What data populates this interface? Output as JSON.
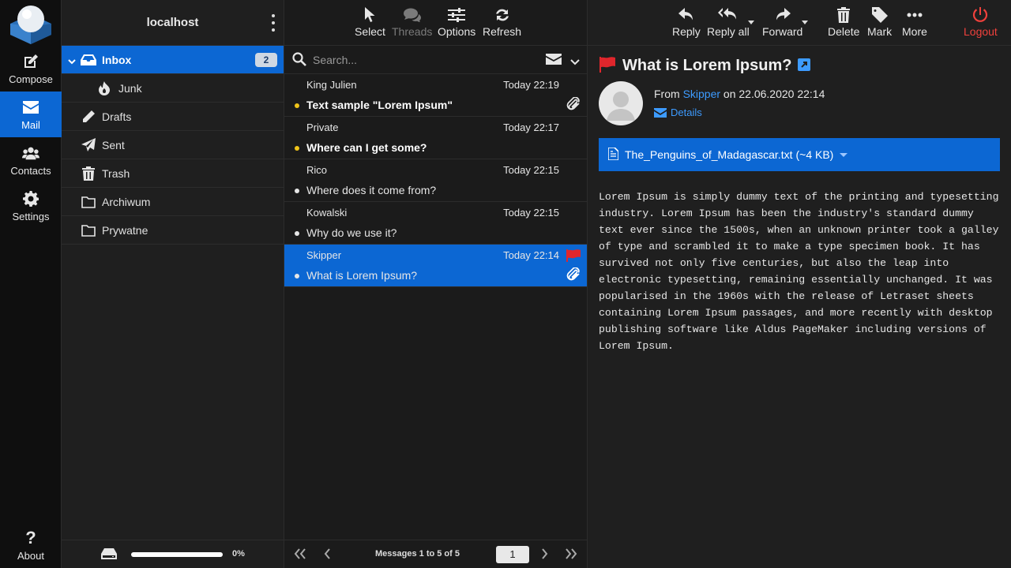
{
  "rail": {
    "compose": "Compose",
    "mail": "Mail",
    "contacts": "Contacts",
    "settings": "Settings",
    "about": "About"
  },
  "folders": {
    "header": "localhost",
    "items": [
      {
        "name": "Inbox",
        "count": "2"
      },
      {
        "name": "Junk"
      },
      {
        "name": "Drafts"
      },
      {
        "name": "Sent"
      },
      {
        "name": "Trash"
      },
      {
        "name": "Archiwum"
      },
      {
        "name": "Prywatne"
      }
    ],
    "quota": {
      "percent_label": "0%",
      "fill": 1.0
    }
  },
  "list": {
    "toolbar": {
      "select": "Select",
      "threads": "Threads",
      "options": "Options",
      "refresh": "Refresh"
    },
    "search_placeholder": "Search...",
    "messages": [
      {
        "from": "King Julien",
        "date": "Today 22:19",
        "subject": "Text sample \"Lorem Ipsum\""
      },
      {
        "from": "Private",
        "date": "Today 22:17",
        "subject": "Where can I get some?"
      },
      {
        "from": "Rico",
        "date": "Today 22:15",
        "subject": "Where does it come from?"
      },
      {
        "from": "Kowalski",
        "date": "Today 22:15",
        "subject": "Why do we use it?"
      },
      {
        "from": "Skipper",
        "date": "Today 22:14",
        "subject": "What is Lorem Ipsum?"
      }
    ],
    "footer": {
      "count_text": "Messages 1 to 5 of 5",
      "page": "1"
    }
  },
  "view": {
    "toolbar": {
      "reply": "Reply",
      "reply_all": "Reply all",
      "forward": "Forward",
      "delete": "Delete",
      "mark": "Mark",
      "more": "More",
      "logout": "Logout"
    },
    "subject": "What is Lorem Ipsum?",
    "from_prefix": "From",
    "sender": "Skipper",
    "date_text": "on 22.06.2020 22:14",
    "details": "Details",
    "attachment": {
      "name": "The_Penguins_of_Madagascar.txt",
      "size": "(~4 KB)"
    },
    "body": "Lorem Ipsum is simply dummy text of the printing and typesetting industry. Lorem Ipsum has been the industry's standard dummy text ever since the 1500s, when an unknown printer took a galley of type and scrambled it to make a type specimen book. It has survived not only five centuries, but also the leap into electronic typesetting, remaining essentially unchanged. It was popularised in the 1960s with the release of Letraset sheets containing Lorem Ipsum passages, and more recently with desktop publishing software like Aldus PageMaker including versions of Lorem Ipsum."
  },
  "colors": {
    "accent": "#0c67d3",
    "link": "#3d9bff",
    "flag": "#e0262c",
    "unread_dot": "#f0c419",
    "logout": "#f0413c"
  }
}
